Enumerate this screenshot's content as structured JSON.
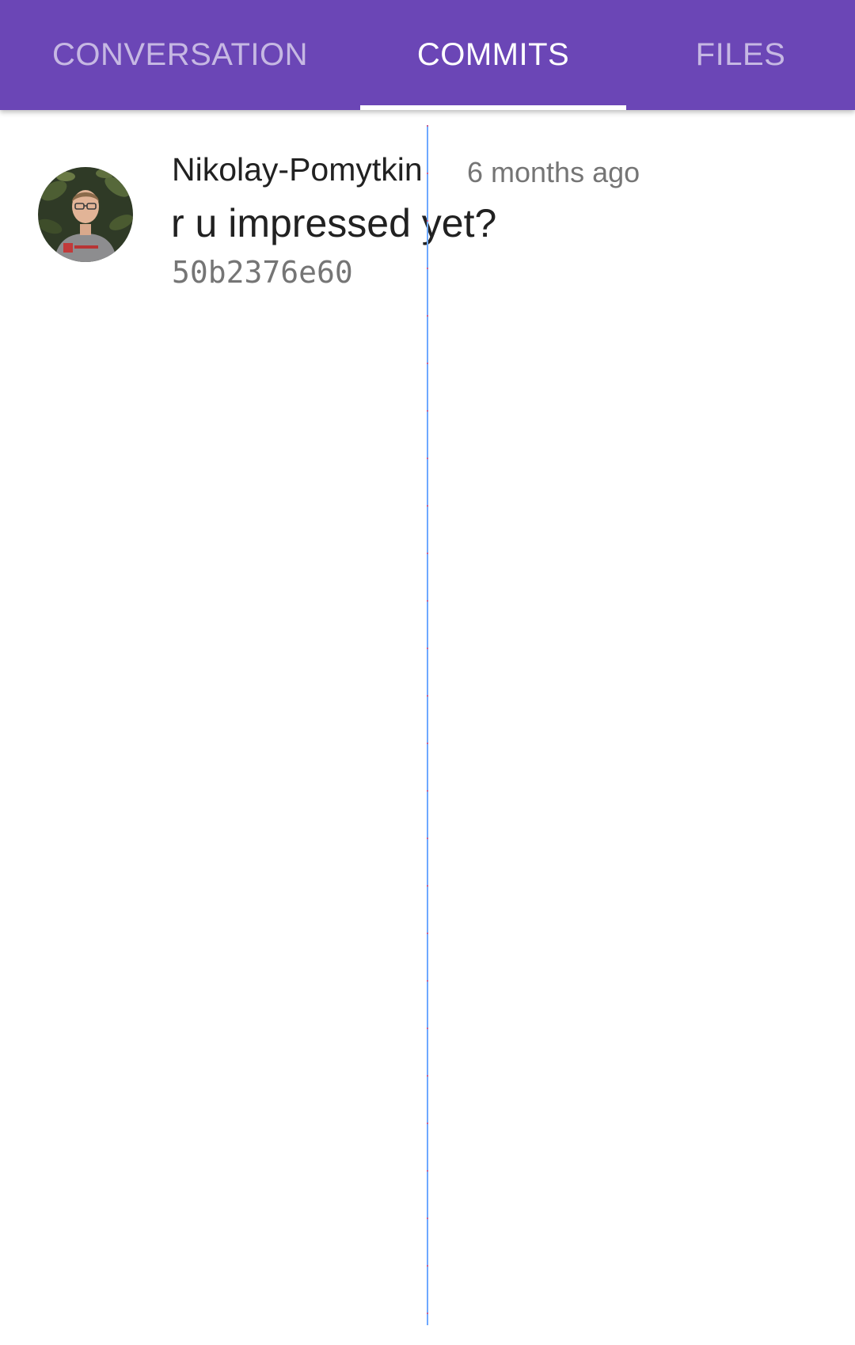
{
  "tabs": [
    {
      "label": "CONVERSATION",
      "active": false
    },
    {
      "label": "COMMITS",
      "active": true
    },
    {
      "label": "FILES",
      "active": false
    }
  ],
  "commits": [
    {
      "author": "Nikolay-Pomytkin",
      "time": "6 months ago",
      "message": "r u impressed yet?",
      "sha": "50b2376e60"
    }
  ],
  "colors": {
    "primary": "#6b46b6",
    "text_primary": "#212121",
    "text_secondary": "#757575"
  }
}
